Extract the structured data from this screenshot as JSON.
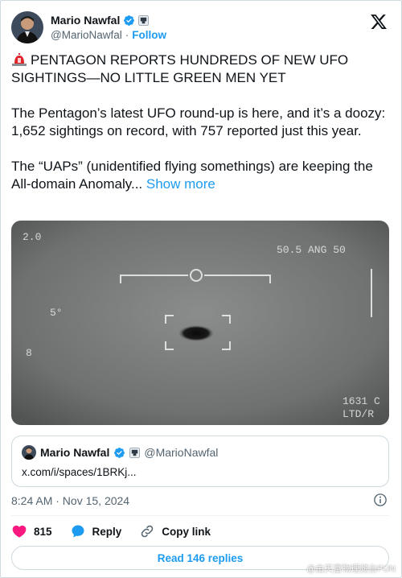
{
  "author": {
    "name": "Mario Nawfal",
    "handle": "@MarioNawfal",
    "separator": "·",
    "follow_label": "Follow"
  },
  "post": {
    "headline": "PENTAGON REPORTS HUNDREDS OF NEW UFO SIGHTINGS—NO LITTLE GREEN MEN YET",
    "paragraph_1": "The Pentagon’s latest UFO round-up is here, and it’s a doozy: 1,652 sightings on record, with 757 reported just this year.",
    "paragraph_2": "The “UAPs” (unidentified flying somethings) are keeping the All-domain Anomaly...",
    "show_more": "Show more"
  },
  "media": {
    "hud_top_left": "2.0",
    "hud_top_right": "50.5 ANG 50",
    "hud_left_number": "5°",
    "hud_left_small": "8",
    "hud_bottom_right_1": "1631 C",
    "hud_bottom_right_2": "LTD/R"
  },
  "quote": {
    "name": "Mario Nawfal",
    "handle": "@MarioNawfal",
    "link": "x.com/i/spaces/1BRKj..."
  },
  "timestamp": "8:24 AM · Nov 15, 2024",
  "actions": {
    "likes_count": "815",
    "reply_label": "Reply",
    "copy_link_label": "Copy link"
  },
  "read_replies_label": "Read 146 replies",
  "watermark": "@由天富物理频台FUN",
  "colors": {
    "accent": "#1d9bf0",
    "like": "#f91880",
    "text": "#0f1419",
    "muted": "#536471",
    "border": "#cfd9de"
  }
}
